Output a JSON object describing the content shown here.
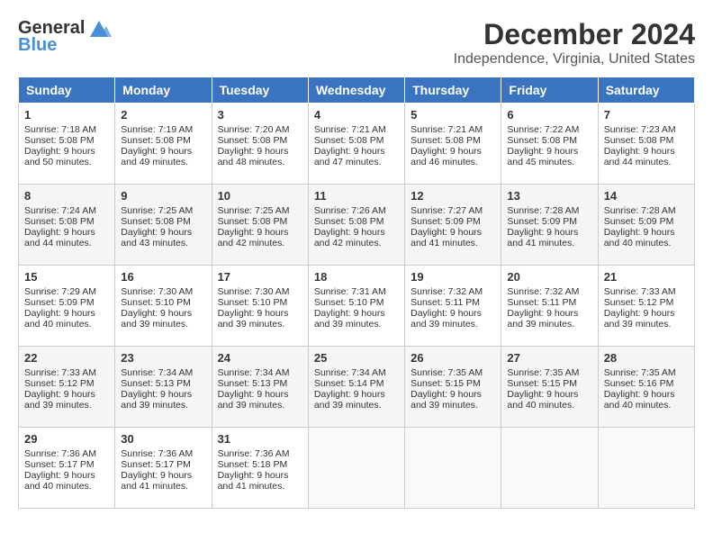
{
  "logo": {
    "general": "General",
    "blue": "Blue"
  },
  "title": {
    "month": "December 2024",
    "location": "Independence, Virginia, United States"
  },
  "headers": [
    "Sunday",
    "Monday",
    "Tuesday",
    "Wednesday",
    "Thursday",
    "Friday",
    "Saturday"
  ],
  "weeks": [
    [
      {
        "day": "1",
        "sunrise": "7:18 AM",
        "sunset": "5:08 PM",
        "daylight": "9 hours and 50 minutes."
      },
      {
        "day": "2",
        "sunrise": "7:19 AM",
        "sunset": "5:08 PM",
        "daylight": "9 hours and 49 minutes."
      },
      {
        "day": "3",
        "sunrise": "7:20 AM",
        "sunset": "5:08 PM",
        "daylight": "9 hours and 48 minutes."
      },
      {
        "day": "4",
        "sunrise": "7:21 AM",
        "sunset": "5:08 PM",
        "daylight": "9 hours and 47 minutes."
      },
      {
        "day": "5",
        "sunrise": "7:21 AM",
        "sunset": "5:08 PM",
        "daylight": "9 hours and 46 minutes."
      },
      {
        "day": "6",
        "sunrise": "7:22 AM",
        "sunset": "5:08 PM",
        "daylight": "9 hours and 45 minutes."
      },
      {
        "day": "7",
        "sunrise": "7:23 AM",
        "sunset": "5:08 PM",
        "daylight": "9 hours and 44 minutes."
      }
    ],
    [
      {
        "day": "8",
        "sunrise": "7:24 AM",
        "sunset": "5:08 PM",
        "daylight": "9 hours and 44 minutes."
      },
      {
        "day": "9",
        "sunrise": "7:25 AM",
        "sunset": "5:08 PM",
        "daylight": "9 hours and 43 minutes."
      },
      {
        "day": "10",
        "sunrise": "7:25 AM",
        "sunset": "5:08 PM",
        "daylight": "9 hours and 42 minutes."
      },
      {
        "day": "11",
        "sunrise": "7:26 AM",
        "sunset": "5:08 PM",
        "daylight": "9 hours and 42 minutes."
      },
      {
        "day": "12",
        "sunrise": "7:27 AM",
        "sunset": "5:09 PM",
        "daylight": "9 hours and 41 minutes."
      },
      {
        "day": "13",
        "sunrise": "7:28 AM",
        "sunset": "5:09 PM",
        "daylight": "9 hours and 41 minutes."
      },
      {
        "day": "14",
        "sunrise": "7:28 AM",
        "sunset": "5:09 PM",
        "daylight": "9 hours and 40 minutes."
      }
    ],
    [
      {
        "day": "15",
        "sunrise": "7:29 AM",
        "sunset": "5:09 PM",
        "daylight": "9 hours and 40 minutes."
      },
      {
        "day": "16",
        "sunrise": "7:30 AM",
        "sunset": "5:10 PM",
        "daylight": "9 hours and 39 minutes."
      },
      {
        "day": "17",
        "sunrise": "7:30 AM",
        "sunset": "5:10 PM",
        "daylight": "9 hours and 39 minutes."
      },
      {
        "day": "18",
        "sunrise": "7:31 AM",
        "sunset": "5:10 PM",
        "daylight": "9 hours and 39 minutes."
      },
      {
        "day": "19",
        "sunrise": "7:32 AM",
        "sunset": "5:11 PM",
        "daylight": "9 hours and 39 minutes."
      },
      {
        "day": "20",
        "sunrise": "7:32 AM",
        "sunset": "5:11 PM",
        "daylight": "9 hours and 39 minutes."
      },
      {
        "day": "21",
        "sunrise": "7:33 AM",
        "sunset": "5:12 PM",
        "daylight": "9 hours and 39 minutes."
      }
    ],
    [
      {
        "day": "22",
        "sunrise": "7:33 AM",
        "sunset": "5:12 PM",
        "daylight": "9 hours and 39 minutes."
      },
      {
        "day": "23",
        "sunrise": "7:34 AM",
        "sunset": "5:13 PM",
        "daylight": "9 hours and 39 minutes."
      },
      {
        "day": "24",
        "sunrise": "7:34 AM",
        "sunset": "5:13 PM",
        "daylight": "9 hours and 39 minutes."
      },
      {
        "day": "25",
        "sunrise": "7:34 AM",
        "sunset": "5:14 PM",
        "daylight": "9 hours and 39 minutes."
      },
      {
        "day": "26",
        "sunrise": "7:35 AM",
        "sunset": "5:15 PM",
        "daylight": "9 hours and 39 minutes."
      },
      {
        "day": "27",
        "sunrise": "7:35 AM",
        "sunset": "5:15 PM",
        "daylight": "9 hours and 40 minutes."
      },
      {
        "day": "28",
        "sunrise": "7:35 AM",
        "sunset": "5:16 PM",
        "daylight": "9 hours and 40 minutes."
      }
    ],
    [
      {
        "day": "29",
        "sunrise": "7:36 AM",
        "sunset": "5:17 PM",
        "daylight": "9 hours and 40 minutes."
      },
      {
        "day": "30",
        "sunrise": "7:36 AM",
        "sunset": "5:17 PM",
        "daylight": "9 hours and 41 minutes."
      },
      {
        "day": "31",
        "sunrise": "7:36 AM",
        "sunset": "5:18 PM",
        "daylight": "9 hours and 41 minutes."
      },
      null,
      null,
      null,
      null
    ]
  ],
  "labels": {
    "sunrise": "Sunrise:",
    "sunset": "Sunset:",
    "daylight": "Daylight:"
  }
}
